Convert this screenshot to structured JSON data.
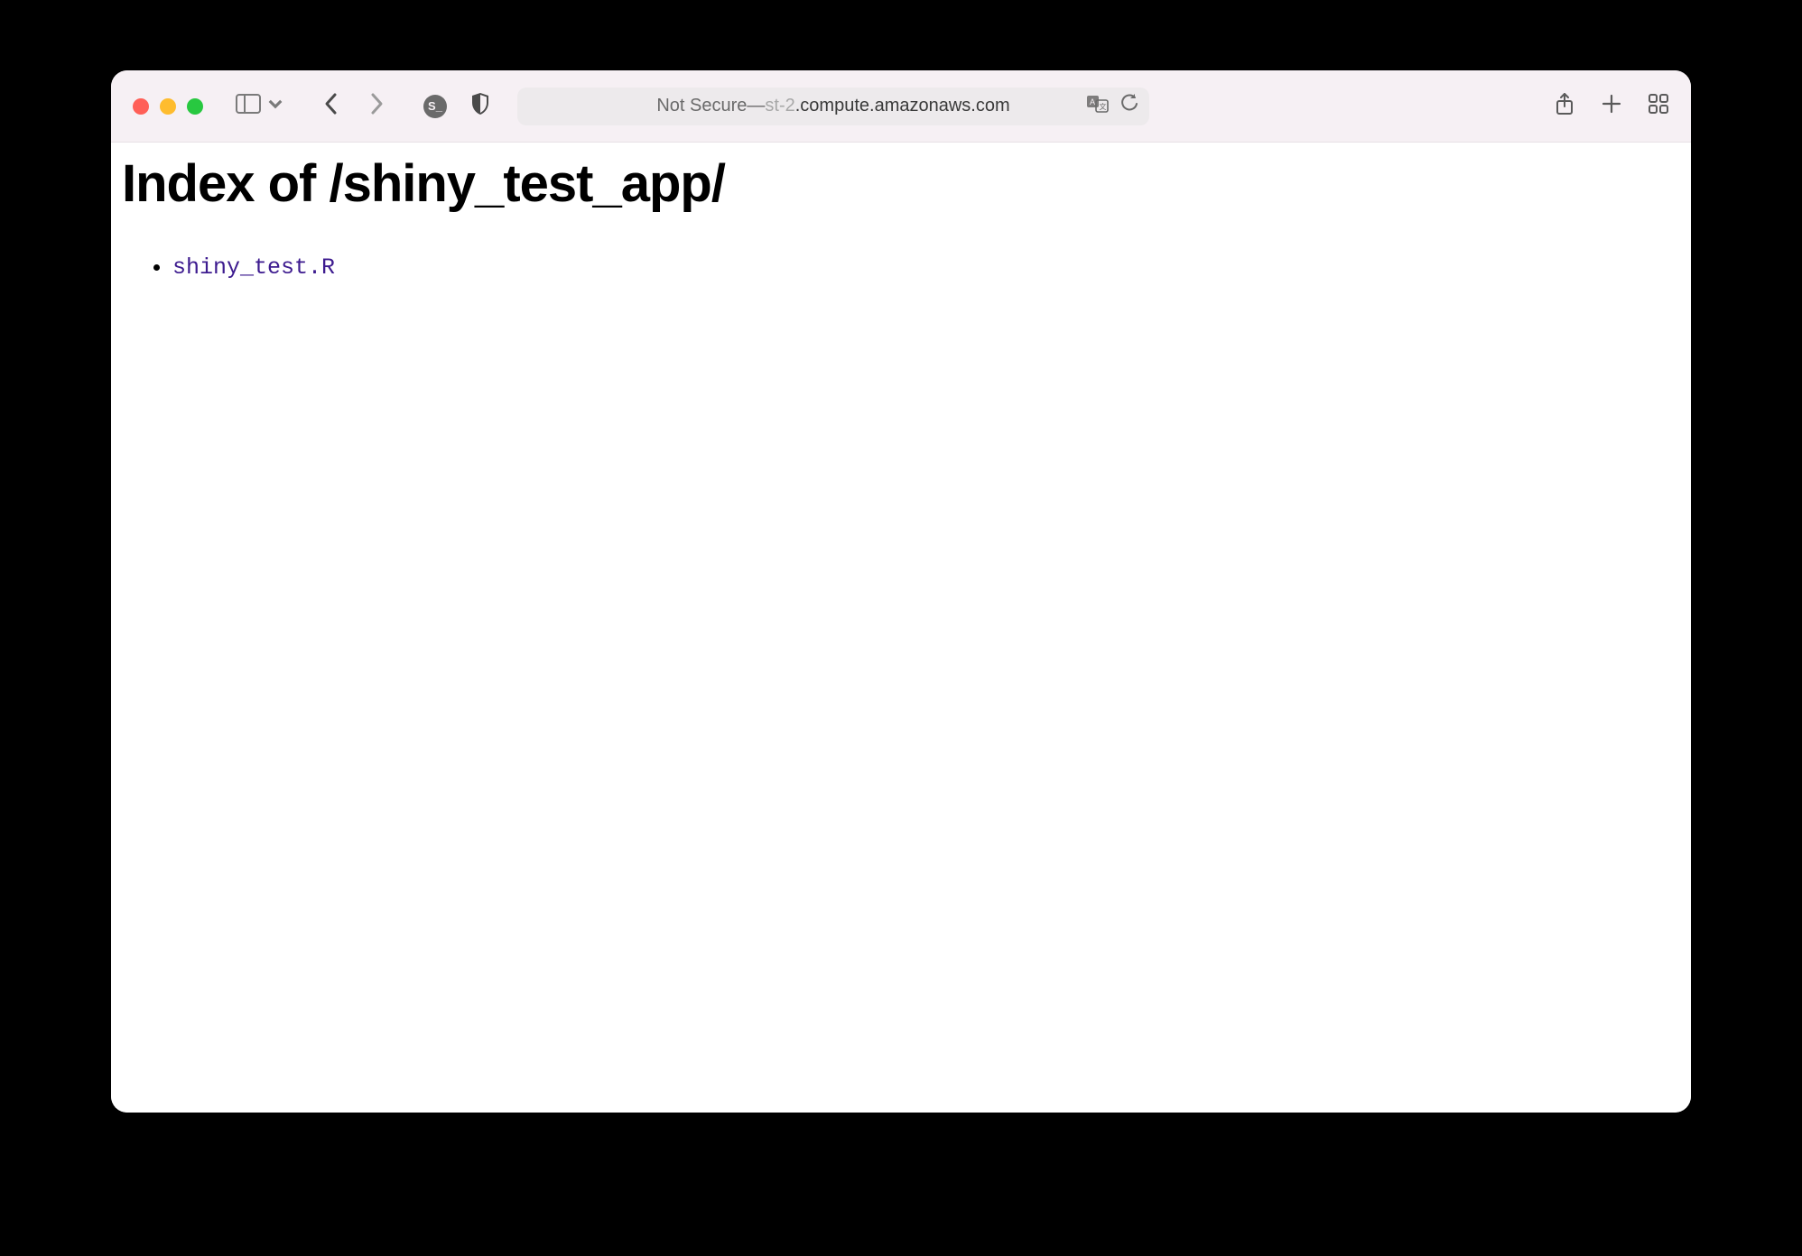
{
  "browser": {
    "address": {
      "secure_label": "Not Secure",
      "separator": " — ",
      "domain_dim": "st-2",
      "domain_main": ".compute.amazonaws.com"
    },
    "site_badge": "S_"
  },
  "page": {
    "title": "Index of /shiny_test_app/",
    "files": [
      {
        "name": "shiny_test.R"
      }
    ]
  }
}
